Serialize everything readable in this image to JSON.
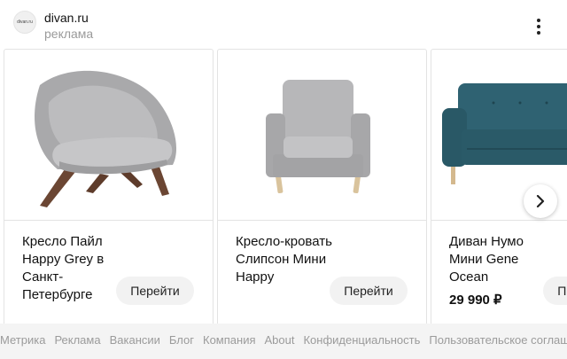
{
  "advertiser": {
    "logo_text": "divan.ru",
    "name": "divan.ru",
    "label": "реклама"
  },
  "icons": {
    "menu": "more-vertical-icon",
    "next": "chevron-right-icon"
  },
  "colors": {
    "teal_sofa": "#2a5a68",
    "grey_chair": "#b7b7b9",
    "button_bg": "#f2f2f2",
    "footer_bg": "#f4f4f4"
  },
  "cards": [
    {
      "title": "Кресло Пайл Happy Grey в Санкт-Петербурге",
      "price": "",
      "button": "Перейти"
    },
    {
      "title": "Кресло-кровать Слипсон Мини Happy",
      "price": "",
      "button": "Перейти"
    },
    {
      "title": "Диван Нумо Мини Gene Ocean",
      "price": "29 990 ₽",
      "button": "Перейти"
    }
  ],
  "footer": {
    "links": [
      "Метрика",
      "Реклама",
      "Вакансии",
      "Блог",
      "Компания",
      "About",
      "Конфиденциальность",
      "Пользовательское соглашение"
    ]
  }
}
